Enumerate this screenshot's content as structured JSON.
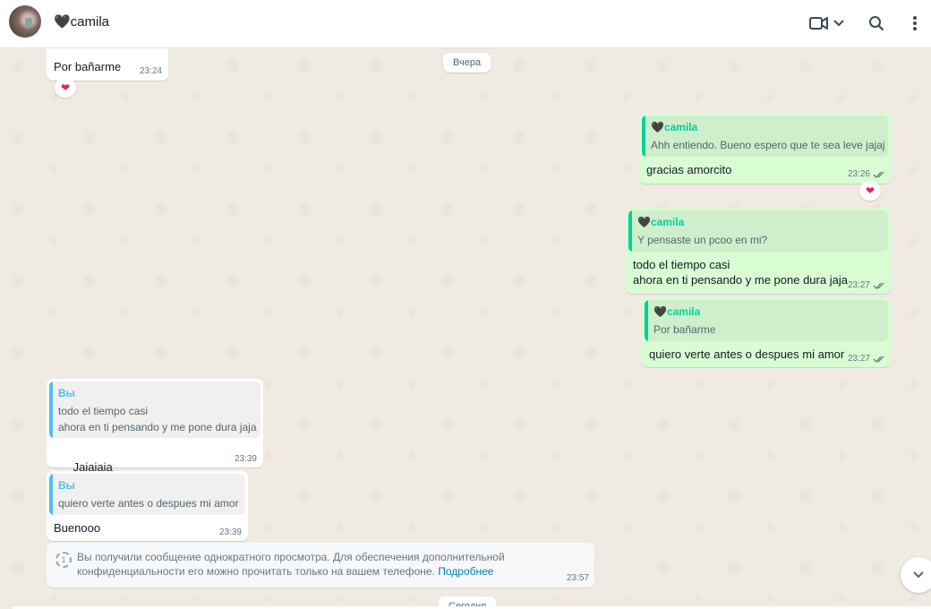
{
  "header": {
    "contact_name": "🖤camila",
    "icons": [
      "avatar",
      "video-call-icon",
      "chevron-down-icon",
      "search-icon",
      "menu-icon"
    ]
  },
  "messages": {
    "m1": {
      "text": "Por bañarme",
      "time": "23:24",
      "reaction": "❤"
    },
    "date_yesterday": "Вчера",
    "m2": {
      "quote_author": "🖤camila",
      "quote_text": "Ahh entiendo. Bueno espero que te sea leve jajaj",
      "text": "gracias amorcito",
      "time": "23:26",
      "reaction": "❤"
    },
    "m3": {
      "quote_author": "🖤camila",
      "quote_text": "Y pensaste un pcoo en mi?",
      "text": "todo el tiempo casi\nahora en ti pensando y me pone dura jaja",
      "time": "23:27"
    },
    "m4": {
      "quote_author": "🖤camila",
      "quote_text": "Por bañarme",
      "text": "quiero verte antes o despues mi amor",
      "time": "23:27"
    },
    "m5": {
      "quote_author": "Вы",
      "quote_text": "todo el tiempo casi\nahora en ti pensando y me pone dura jaja",
      "text": "Jajajaja",
      "time": "23:39"
    },
    "m6": {
      "quote_author": "Вы",
      "quote_text": "quiero verte antes o despues mi amor",
      "text": "Buenooo",
      "time": "23:39"
    },
    "system": {
      "text": "Вы получили сообщение однократного просмотра. Для обеспечения дополнительной конфиденциальности его можно прочитать только на вашем телефоне.",
      "link": "Подробнее",
      "time": "23:57"
    },
    "date_today": "Сегодня"
  },
  "colors": {
    "outgoing": "#d9fdd3",
    "incoming": "#ffffff",
    "accent": "#06cf9c",
    "read_ticks": "#53bdeb"
  }
}
